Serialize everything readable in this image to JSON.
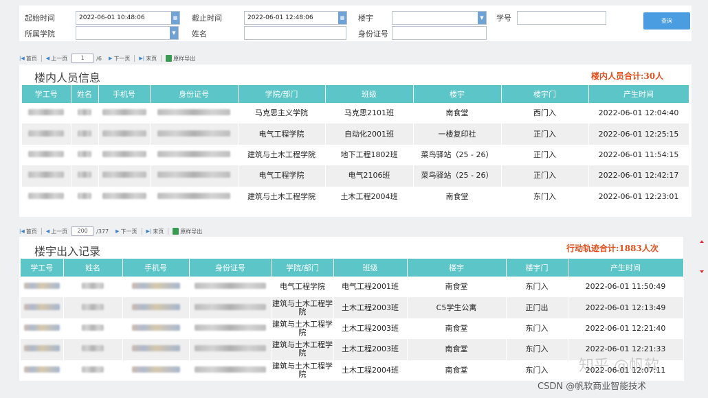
{
  "filters": {
    "start_time_label": "起始时间",
    "start_time_value": "2022-06-01 10:48:06",
    "end_time_label": "截止时间",
    "end_time_value": "2022-06-01 12:48:06",
    "building_label": "楼宇",
    "building_value": "",
    "student_id_label": "学号",
    "student_id_value": "",
    "college_label": "所属学院",
    "college_value": "",
    "name_label": "姓名",
    "name_value": "",
    "id_card_label": "身份证号",
    "id_card_value": "",
    "query_label": "查询"
  },
  "toolbar1": {
    "first": "首页",
    "prev": "上一页",
    "page": "1",
    "total_pages": "/6",
    "next": "下一页",
    "last": "末页",
    "export": "原样导出"
  },
  "toolbar2": {
    "first": "首页",
    "prev": "上一页",
    "page": "200",
    "total_pages": "/377",
    "next": "下一页",
    "last": "末页",
    "export": "原样导出"
  },
  "panel1": {
    "title": "楼内人员信息",
    "total": "楼内人员合计:30人",
    "headers": [
      "学工号",
      "姓名",
      "手机号",
      "身份证号",
      "学院/部门",
      "班级",
      "楼宇",
      "楼宇门",
      "产生时间"
    ],
    "rows": [
      {
        "college": "马克思主义学院",
        "class": "马克思2101班",
        "building": "南食堂",
        "gate": "西门入",
        "time": "2022-06-01 12:04:40"
      },
      {
        "college": "电气工程学院",
        "class": "自动化2001班",
        "building": "一楼复印社",
        "gate": "正门入",
        "time": "2022-06-01 12:25:15"
      },
      {
        "college": "建筑与土木工程学院",
        "class": "地下工程1802班",
        "building": "菜鸟驿站（25 - 26）",
        "gate": "正门入",
        "time": "2022-06-01 11:54:15"
      },
      {
        "college": "电气工程学院",
        "class": "电气2106班",
        "building": "菜鸟驿站（25 - 26）",
        "gate": "正门入",
        "time": "2022-06-01 12:42:17"
      },
      {
        "college": "建筑与土木工程学院",
        "class": "土木工程2004班",
        "building": "南食堂",
        "gate": "东门入",
        "time": "2022-06-01 12:23:01"
      }
    ]
  },
  "panel2": {
    "title": "楼宇出入记录",
    "total": "行动轨迹合计:1883人次",
    "headers": [
      "学工号",
      "姓名",
      "手机号",
      "身份证号",
      "学院/部门",
      "班级",
      "楼宇",
      "楼宇门",
      "产生时间"
    ],
    "rows": [
      {
        "college": "电气工程学院",
        "class": "电气工程2001班",
        "building": "南食堂",
        "gate": "东门入",
        "time": "2022-06-01 11:50:49"
      },
      {
        "college": "建筑与土木工程学院",
        "class": "土木工程2003班",
        "building": "C5学生公寓",
        "gate": "正门出",
        "time": "2022-06-01 12:13:49"
      },
      {
        "college": "建筑与土木工程学院",
        "class": "土木工程2003班",
        "building": "南食堂",
        "gate": "东门入",
        "time": "2022-06-01 12:21:40"
      },
      {
        "college": "建筑与土木工程学院",
        "class": "土木工程2003班",
        "building": "南食堂",
        "gate": "东门入",
        "time": "2022-06-01 12:21:33"
      },
      {
        "college": "建筑与土木工程学院",
        "class": "土木工程2004班",
        "building": "南食堂",
        "gate": "东门入",
        "time": "2022-06-01 12:07:11"
      }
    ]
  },
  "watermarks": {
    "zhihu": "知乎 @帆软",
    "csdn": "CSDN @帆软商业智能技术"
  }
}
